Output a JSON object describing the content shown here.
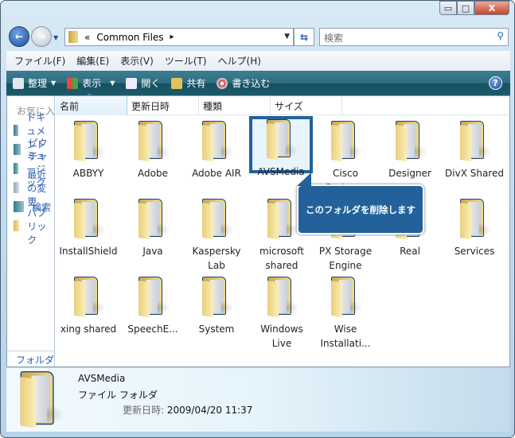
{
  "window": {
    "controls": {
      "minimize": "▭",
      "maximize": "□",
      "close": "X"
    }
  },
  "nav": {
    "back": "←",
    "forward": "→",
    "address_prefix": "«",
    "address": "Common Files",
    "address_arrow": "▸",
    "search_placeholder": "検索"
  },
  "menu": [
    "ファイル(F)",
    "編集(E)",
    "表示(V)",
    "ツール(T)",
    "ヘルプ(H)"
  ],
  "toolbar": {
    "organize": "整理",
    "view": "表示",
    "open": "開く",
    "share": "共有",
    "burn": "書き込む",
    "help": "?"
  },
  "navpane": {
    "header": "お気に入りリンク",
    "links": [
      "ドキュメント",
      "ピクチャ",
      "ミュージック",
      "最近の変更",
      "検索",
      "パブリック"
    ],
    "footer": "フォルダ"
  },
  "columns": [
    "名前",
    "更新日時",
    "種類",
    "サイズ"
  ],
  "items": [
    "ABBYY",
    "Adobe",
    "Adobe AIR",
    "AVSMedia",
    "Cisco Systems",
    "Designer",
    "DivX Shared",
    "InstallShield",
    "Java",
    "Kaspersky Lab",
    "microsoft shared",
    "PX Storage Engine",
    "Real",
    "Services",
    "xing shared",
    "SpeechE...",
    "System",
    "Windows Live",
    "Wise Installati..."
  ],
  "selected": "AVSMedia",
  "tooltip": "このフォルダを削除します",
  "details": {
    "name": "AVSMedia",
    "type": "ファイル フォルダ",
    "modified_label": "更新日時:",
    "modified": "2009/04/20 11:37"
  }
}
